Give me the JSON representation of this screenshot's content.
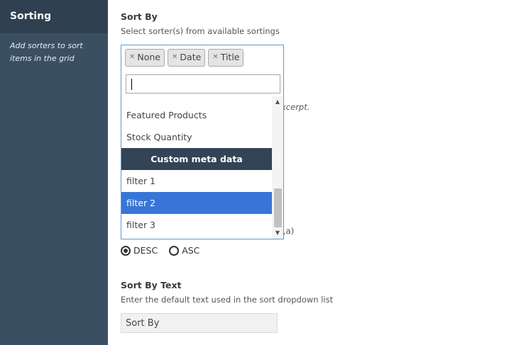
{
  "sidebar": {
    "title": "Sorting",
    "description": "Add sorters to sort items in the grid"
  },
  "sort_by": {
    "label": "Sort By",
    "help": "Select sorter(s) from available sortings",
    "selected_tags": [
      "None",
      "Date",
      "Title"
    ],
    "search_value": "",
    "options": [
      {
        "label": "Featured Products",
        "type": "option"
      },
      {
        "label": "Stock Quantity",
        "type": "option"
      },
      {
        "label": "Custom meta data",
        "type": "group"
      },
      {
        "label": "filter 1",
        "type": "option"
      },
      {
        "label": "filter 2",
        "type": "option",
        "highlighted": true
      },
      {
        "label": "filter 3",
        "type": "option"
      }
    ],
    "hidden_text_1": "xcerpt.",
    "hidden_text_2": ",a)"
  },
  "order": {
    "options": [
      {
        "label": "DESC",
        "checked": true
      },
      {
        "label": "ASC",
        "checked": false
      }
    ]
  },
  "sort_by_text": {
    "label": "Sort By Text",
    "help": "Enter the default text used in the sort dropdown list",
    "value": "Sort By"
  },
  "colors": {
    "sidebar_bg": "#3b4f63",
    "sidebar_header_bg": "#2f4050",
    "highlight": "#3875d7",
    "group_bg": "#334456"
  }
}
